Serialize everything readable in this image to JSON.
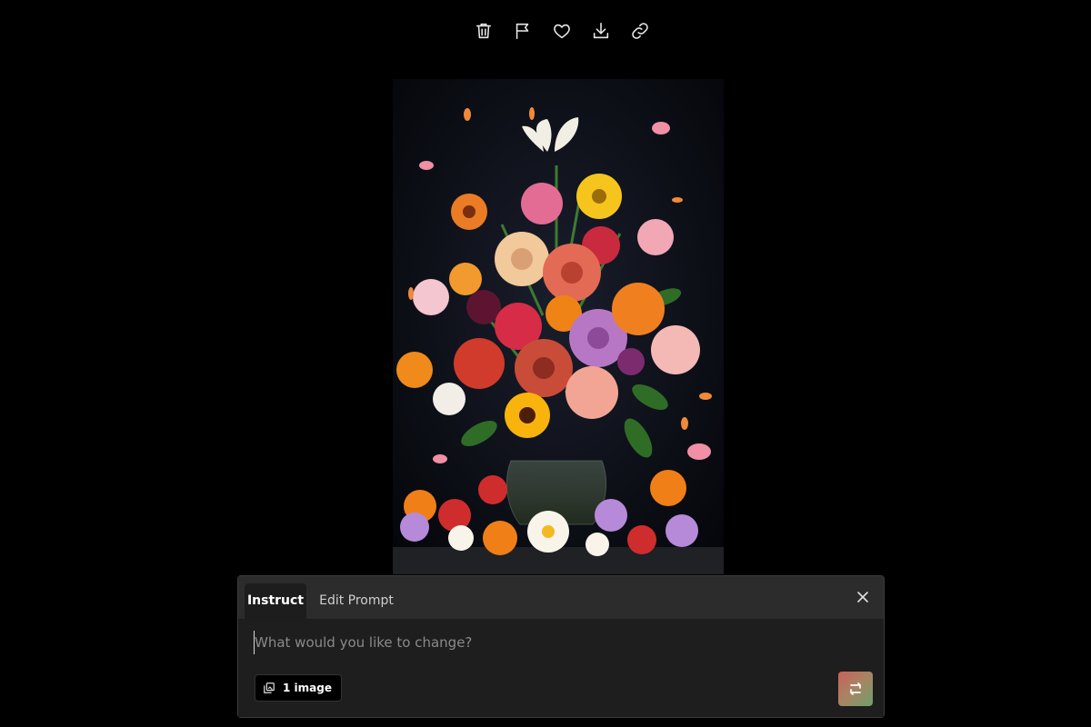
{
  "toolbar": {
    "icons": [
      "trash-icon",
      "flag-icon",
      "heart-icon",
      "download-icon",
      "link-icon"
    ]
  },
  "image": {
    "description_icon": "flower-bouquet-image"
  },
  "panel": {
    "tabs": [
      {
        "label": "Instruct",
        "active": true
      },
      {
        "label": "Edit Prompt",
        "active": false
      }
    ],
    "input": {
      "value": "",
      "placeholder": "What would you like to change?"
    },
    "image_chip_label": "1 image"
  },
  "colors": {
    "background": "#000000",
    "panel": "#1e1e1e",
    "tabbar": "#2c2c2c",
    "submit_gradient_start": "#c8605a",
    "submit_gradient_end": "#6f9f6b"
  }
}
